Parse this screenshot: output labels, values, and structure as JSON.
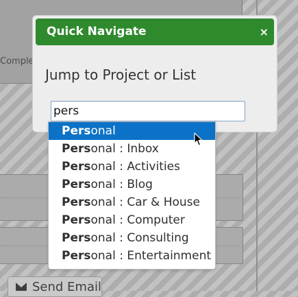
{
  "background": {
    "complete_label": "Complete",
    "send_email_label": "Send Email"
  },
  "dialog": {
    "title": "Quick Navigate",
    "close_glyph": "×",
    "prompt": "Jump to Project or List",
    "input_value": "pers"
  },
  "autocomplete": {
    "selected_index": 0,
    "items": [
      {
        "match": "Pers",
        "rest": "onal"
      },
      {
        "match": "Pers",
        "rest": "onal : Inbox"
      },
      {
        "match": "Pers",
        "rest": "onal : Activities"
      },
      {
        "match": "Pers",
        "rest": "onal : Blog"
      },
      {
        "match": "Pers",
        "rest": "onal : Car & House"
      },
      {
        "match": "Pers",
        "rest": "onal : Computer"
      },
      {
        "match": "Pers",
        "rest": "onal : Consulting"
      },
      {
        "match": "Pers",
        "rest": "onal : Entertainment"
      }
    ]
  },
  "colors": {
    "titlebar": "#2e8a2c",
    "selected_item": "#0b72c7"
  }
}
